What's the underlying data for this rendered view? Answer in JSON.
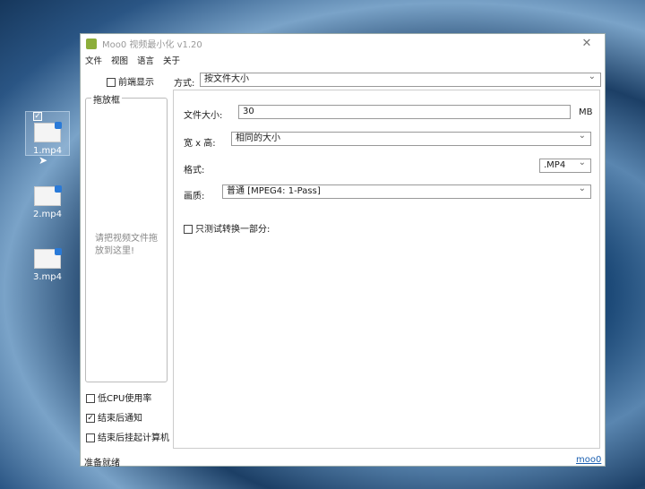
{
  "desktop": {
    "icons": [
      {
        "label": "1.mp4",
        "selected": true
      },
      {
        "label": "2.mp4"
      },
      {
        "label": "3.mp4"
      }
    ]
  },
  "window": {
    "title": "Moo0 视频最小化 v1.20",
    "close": "✕",
    "menu": [
      "文件",
      "视图",
      "语言",
      "关于"
    ],
    "front_display": "前端显示",
    "method_label": "方式:",
    "method_value": "按文件大小",
    "dropbox_title": "拖放框",
    "dropbox_hint": "请把视频文件拖放到这里!",
    "file_size_label": "文件大小:",
    "file_size_value": "30",
    "file_size_unit": "MB",
    "wh_label": "宽 x 高:",
    "wh_value": "相同的大小",
    "format_label": "格式:",
    "format_value": ".MP4",
    "quality_label": "画质:",
    "quality_value": "普通  [MPEG4: 1-Pass]",
    "test_part": "只测试转换一部分:",
    "low_cpu": "低CPU使用率",
    "notify": "结束后通知",
    "suspend": "结束后挂起计算机",
    "status": "准备就绪",
    "link": "moo0"
  }
}
